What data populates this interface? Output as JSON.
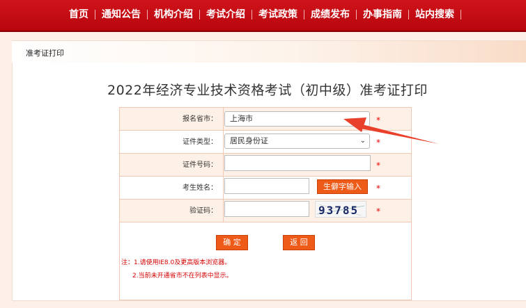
{
  "nav": {
    "items": [
      "首页",
      "通知公告",
      "机构介绍",
      "考试介绍",
      "考试政策",
      "成绩发布",
      "办事指南",
      "站内搜索"
    ]
  },
  "breadcrumb": "准考证打印",
  "page_title": "2022年经济专业技术资格考试（初中级）准考证打印",
  "form": {
    "province_label": "报名省市：",
    "province_value": "上海市",
    "id_type_label": "证件类型：",
    "id_type_value": "居民身份证",
    "id_number_label": "证件号码：",
    "name_label": "考生姓名：",
    "rare_char_button": "生僻字输入",
    "captcha_label": "验证码：",
    "captcha_text": "93785",
    "required_mark": "*"
  },
  "buttons": {
    "confirm": "确 定",
    "back": "返 回"
  },
  "notes": {
    "line1": "注：1.请使用IE8.0及更高版本浏览器。",
    "line2": "2.当前未开通省市不在列表中显示。"
  },
  "colors": {
    "nav_red": "#c80d14",
    "button_orange": "#ee5a17",
    "required_red": "#e00000",
    "annotation_arrow": "#e8402a"
  }
}
